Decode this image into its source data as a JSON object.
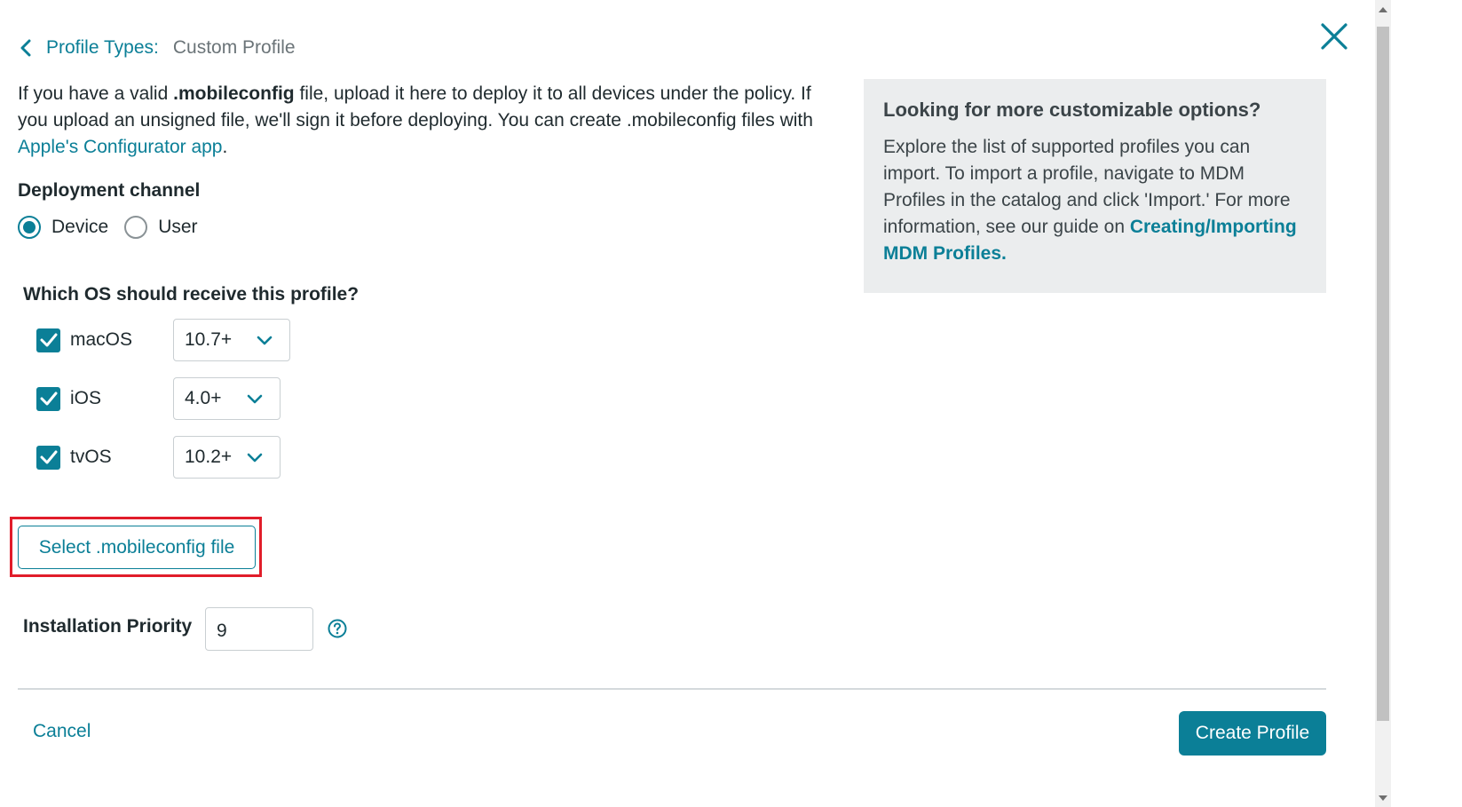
{
  "breadcrumb": {
    "parent": "Profile Types:",
    "current": "Custom Profile"
  },
  "intro": {
    "text_1": "If you have a valid ",
    "bold": ".mobileconfig",
    "text_2": " file, upload it here to deploy it to all devices under the policy. If you upload an unsigned file, we'll sign it before deploying. You can create .mobileconfig files with ",
    "link": "Apple's Configurator app",
    "text_3": "."
  },
  "deployment": {
    "title": "Deployment channel",
    "options": [
      {
        "label": "Device",
        "selected": true
      },
      {
        "label": "User",
        "selected": false
      }
    ]
  },
  "os": {
    "title": "Which OS should receive this profile?",
    "rows": [
      {
        "label": "macOS",
        "checked": true,
        "version": "10.7+"
      },
      {
        "label": "iOS",
        "checked": true,
        "version": "4.0+"
      },
      {
        "label": "tvOS",
        "checked": true,
        "version": "10.2+"
      }
    ]
  },
  "file_button": "Select .mobileconfig file",
  "priority": {
    "label": "Installation Priority",
    "value": "9"
  },
  "footer": {
    "cancel": "Cancel",
    "create": "Create Profile"
  },
  "info_panel": {
    "title": "Looking for more customizable options?",
    "body": "Explore the list of supported profiles you can import. To import a profile, navigate to MDM Profiles in the catalog and click 'Import.' For more information, see our guide on ",
    "link": "Creating/Importing MDM Profiles."
  },
  "colors": {
    "accent": "#0b7f97",
    "highlight": "#e11d2a",
    "panel_bg": "#ebedee"
  },
  "icons": [
    "chevron-left-icon",
    "close-icon",
    "check-icon",
    "chevron-down-icon",
    "help-icon"
  ]
}
